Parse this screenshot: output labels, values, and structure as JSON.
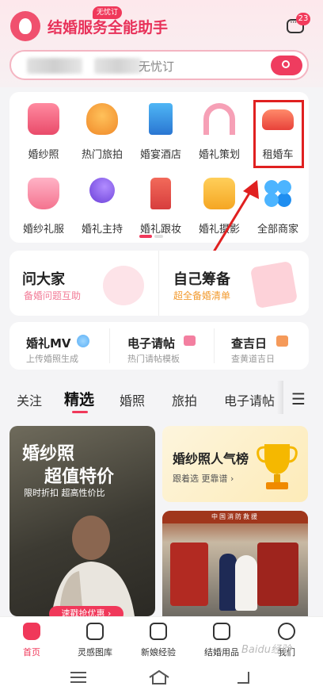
{
  "header": {
    "app_title": "结婚服务全能助手",
    "badge_count": "23",
    "search_placeholder": "无忧订"
  },
  "categories": [
    {
      "label": "婚纱照",
      "icon": "camera-icon"
    },
    {
      "label": "热门旅拍",
      "icon": "hot-air-balloon-icon",
      "tag": "无忧订"
    },
    {
      "label": "婚宴酒店",
      "icon": "hotel-building-icon"
    },
    {
      "label": "婚礼策划",
      "icon": "floral-arch-icon"
    },
    {
      "label": "租婚车",
      "icon": "car-icon"
    },
    {
      "label": "婚纱礼服",
      "icon": "dress-icon"
    },
    {
      "label": "婚礼主持",
      "icon": "microphone-icon"
    },
    {
      "label": "婚礼跟妆",
      "icon": "lipstick-icon"
    },
    {
      "label": "婚礼摄影",
      "icon": "photo-frame-icon"
    },
    {
      "label": "全部商家",
      "icon": "clover-grid-icon"
    }
  ],
  "cards": {
    "ask": {
      "title": "问大家",
      "sub": "备婚问题互助"
    },
    "prepare": {
      "title": "自己筹备",
      "sub": "超全备婚清单"
    }
  },
  "tools": [
    {
      "title": "婚礼MV",
      "sub": "上传婚照生成"
    },
    {
      "title": "电子请帖",
      "sub": "热门请帖模板"
    },
    {
      "title": "查吉日",
      "sub": "查黄道吉日"
    }
  ],
  "tabs": [
    "关注",
    "精选",
    "婚照",
    "旅拍",
    "电子请帖"
  ],
  "feed": {
    "promo_title": "婚纱照",
    "promo_sub": "超值特价",
    "promo_line": "限时折扣 超高性价比",
    "promo_button": "速戳抢优惠 ›",
    "ranking_title": "婚纱照人气榜",
    "ranking_sub": "跟着选 更靠谱 ›",
    "firestation_sign": "中国消防救援"
  },
  "bottom_nav": [
    {
      "label": "首页",
      "icon": "home-icon"
    },
    {
      "label": "灵感图库",
      "icon": "image-icon"
    },
    {
      "label": "新娘经验",
      "icon": "note-icon"
    },
    {
      "label": "结婚用品",
      "icon": "shopping-bag-icon"
    },
    {
      "label": "我们",
      "icon": "users-icon"
    }
  ],
  "watermark": "Baidu经验"
}
